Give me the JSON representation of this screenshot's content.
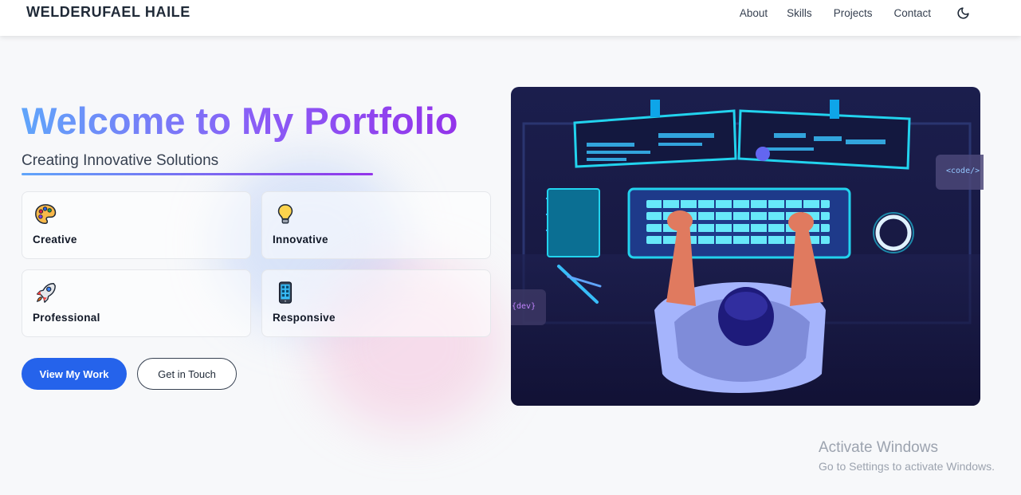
{
  "header": {
    "brand": "WELDERUFAEL HAILE",
    "nav": [
      {
        "label": "About"
      },
      {
        "label": "Skills"
      },
      {
        "label": "Projects"
      },
      {
        "label": "Contact"
      }
    ],
    "theme_toggle_icon": "moon-icon"
  },
  "hero": {
    "title": "Welcome to My Portfolio",
    "subtitle": "Creating Innovative Solutions",
    "features": [
      {
        "label": "Creative",
        "icon": "palette-icon"
      },
      {
        "label": "Innovative",
        "icon": "lightbulb-icon"
      },
      {
        "label": "Professional",
        "icon": "rocket-icon"
      },
      {
        "label": "Responsive",
        "icon": "mobile-phone-icon"
      }
    ],
    "primary_button": "View My Work",
    "secondary_button": "Get in Touch",
    "image_badges": {
      "code": "<code/>",
      "dev": "{dev}"
    }
  },
  "watermark": {
    "title": "Activate Windows",
    "subtitle": "Go to Settings to activate Windows."
  },
  "colors": {
    "accent": "#2563eb",
    "gradient_start": "#60a5fa",
    "gradient_end": "#9333ea"
  }
}
